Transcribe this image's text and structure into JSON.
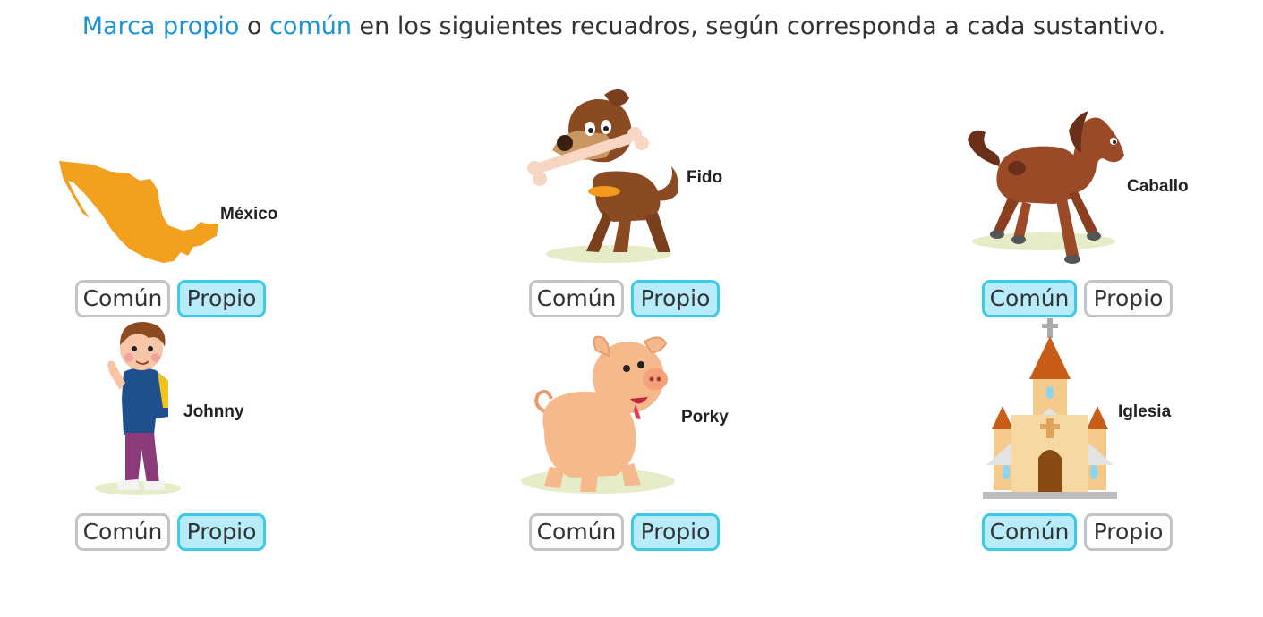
{
  "instruction": {
    "part1": "Marca propio",
    "part2": " o ",
    "part3": "común",
    "part4": " en los siguientes recuadros, según corresponda a cada sustantivo."
  },
  "colors": {
    "accent": "#1c93d4",
    "selected_bg": "#b8ecfb",
    "selected_border": "#3cc9ea",
    "button_border": "#c4c4c4"
  },
  "items": [
    {
      "name": "México",
      "image": "mexico-map",
      "options": [
        "Común",
        "Propio"
      ],
      "selected": "Propio"
    },
    {
      "name": "Fido",
      "image": "dog",
      "options": [
        "Común",
        "Propio"
      ],
      "selected": "Propio"
    },
    {
      "name": "Caballo",
      "image": "horse",
      "options": [
        "Común",
        "Propio"
      ],
      "selected": "Común"
    },
    {
      "name": "Johnny",
      "image": "boy",
      "options": [
        "Común",
        "Propio"
      ],
      "selected": "Propio"
    },
    {
      "name": "Porky",
      "image": "pig",
      "options": [
        "Común",
        "Propio"
      ],
      "selected": "Propio"
    },
    {
      "name": "Iglesia",
      "image": "church",
      "options": [
        "Común",
        "Propio"
      ],
      "selected": "Común"
    }
  ]
}
